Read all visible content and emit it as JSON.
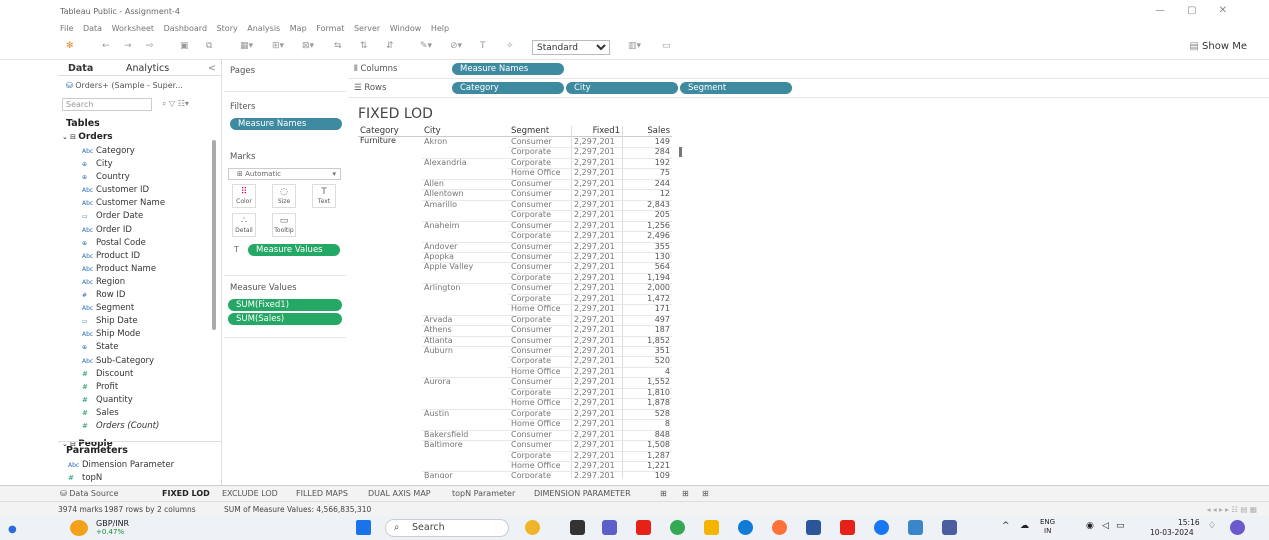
{
  "window": {
    "title": "Tableau Public - Assignment-4"
  },
  "menu": [
    "File",
    "Data",
    "Worksheet",
    "Dashboard",
    "Story",
    "Analysis",
    "Map",
    "Format",
    "Server",
    "Window",
    "Help"
  ],
  "toolbar": {
    "fit_value": "Standard",
    "show_me": "Show Me"
  },
  "data_pane": {
    "tab_data": "Data",
    "tab_analytics": "Analytics",
    "collapse": "<",
    "datasource": "Orders+ (Sample - Super...",
    "search_placeholder": "Search",
    "tables_label": "Tables",
    "orders_label": "Orders",
    "fields": [
      {
        "type": "Abc",
        "name": "Category"
      },
      {
        "type": "⊕",
        "name": "City"
      },
      {
        "type": "⊕",
        "name": "Country"
      },
      {
        "type": "Abc",
        "name": "Customer ID"
      },
      {
        "type": "Abc",
        "name": "Customer Name"
      },
      {
        "type": "▭",
        "name": "Order Date"
      },
      {
        "type": "Abc",
        "name": "Order ID"
      },
      {
        "type": "⊕",
        "name": "Postal Code"
      },
      {
        "type": "Abc",
        "name": "Product ID"
      },
      {
        "type": "Abc",
        "name": "Product Name"
      },
      {
        "type": "Abc",
        "name": "Region"
      },
      {
        "type": "#",
        "name": "Row ID"
      },
      {
        "type": "Abc",
        "name": "Segment"
      },
      {
        "type": "▭",
        "name": "Ship Date"
      },
      {
        "type": "Abc",
        "name": "Ship Mode"
      },
      {
        "type": "⊕",
        "name": "State"
      },
      {
        "type": "Abc",
        "name": "Sub-Category"
      },
      {
        "type": "#",
        "name": "Discount",
        "measure": true
      },
      {
        "type": "#",
        "name": "Profit",
        "measure": true
      },
      {
        "type": "#",
        "name": "Quantity",
        "measure": true
      },
      {
        "type": "#",
        "name": "Sales",
        "measure": true
      },
      {
        "type": "#",
        "name": "Orders (Count)",
        "measure": true,
        "italic": true
      }
    ],
    "people_label": "People",
    "parameters_label": "Parameters",
    "parameters": [
      {
        "type": "Abc",
        "name": "Dimension Parameter"
      },
      {
        "type": "#",
        "name": "topN"
      }
    ]
  },
  "cards": {
    "pages": "Pages",
    "filters": "Filters",
    "filter_pill": "Measure Names",
    "marks": "Marks",
    "mark_type": "Automatic",
    "mark_buttons": [
      {
        "name": "color",
        "label": "Color",
        "glyph": "⠿"
      },
      {
        "name": "size",
        "label": "Size",
        "glyph": "◌"
      },
      {
        "name": "text",
        "label": "Text",
        "glyph": "T"
      },
      {
        "name": "detail",
        "label": "Detail",
        "glyph": "∴"
      },
      {
        "name": "tooltip",
        "label": "Tooltip",
        "glyph": "▭"
      }
    ],
    "marks_pill": "Measure Values",
    "measure_values": "Measure Values",
    "mv_pills": [
      "SUM(Fixed1)",
      "SUM(Sales)"
    ]
  },
  "shelves": {
    "columns_label": "Columns",
    "rows_label": "Rows",
    "columns_pills": [
      "Measure Names"
    ],
    "rows_pills": [
      "Category",
      "City",
      "Segment"
    ]
  },
  "view": {
    "title": "FIXED LOD",
    "headers": [
      "Category",
      "City",
      "Segment",
      "Fixed1",
      "Sales"
    ],
    "category": "Furniture",
    "rows": [
      {
        "city": "Akron",
        "segment": "Consumer",
        "fixed1": "2,297,201",
        "sales": "149"
      },
      {
        "city": "",
        "segment": "Corporate",
        "fixed1": "2,297,201",
        "sales": "284"
      },
      {
        "city": "Alexandria",
        "segment": "Corporate",
        "fixed1": "2,297,201",
        "sales": "192"
      },
      {
        "city": "",
        "segment": "Home Office",
        "fixed1": "2,297,201",
        "sales": "75"
      },
      {
        "city": "Allen",
        "segment": "Consumer",
        "fixed1": "2,297,201",
        "sales": "244"
      },
      {
        "city": "Allentown",
        "segment": "Consumer",
        "fixed1": "2,297,201",
        "sales": "12"
      },
      {
        "city": "Amarillo",
        "segment": "Consumer",
        "fixed1": "2,297,201",
        "sales": "2,843"
      },
      {
        "city": "",
        "segment": "Corporate",
        "fixed1": "2,297,201",
        "sales": "205"
      },
      {
        "city": "Anaheim",
        "segment": "Consumer",
        "fixed1": "2,297,201",
        "sales": "1,256"
      },
      {
        "city": "",
        "segment": "Corporate",
        "fixed1": "2,297,201",
        "sales": "2,496"
      },
      {
        "city": "Andover",
        "segment": "Consumer",
        "fixed1": "2,297,201",
        "sales": "355"
      },
      {
        "city": "Apopka",
        "segment": "Consumer",
        "fixed1": "2,297,201",
        "sales": "130"
      },
      {
        "city": "Apple Valley",
        "segment": "Consumer",
        "fixed1": "2,297,201",
        "sales": "564"
      },
      {
        "city": "",
        "segment": "Corporate",
        "fixed1": "2,297,201",
        "sales": "1,194"
      },
      {
        "city": "Arlington",
        "segment": "Consumer",
        "fixed1": "2,297,201",
        "sales": "2,000"
      },
      {
        "city": "",
        "segment": "Corporate",
        "fixed1": "2,297,201",
        "sales": "1,472"
      },
      {
        "city": "",
        "segment": "Home Office",
        "fixed1": "2,297,201",
        "sales": "171"
      },
      {
        "city": "Arvada",
        "segment": "Corporate",
        "fixed1": "2,297,201",
        "sales": "497"
      },
      {
        "city": "Athens",
        "segment": "Consumer",
        "fixed1": "2,297,201",
        "sales": "187"
      },
      {
        "city": "Atlanta",
        "segment": "Consumer",
        "fixed1": "2,297,201",
        "sales": "1,852"
      },
      {
        "city": "Auburn",
        "segment": "Consumer",
        "fixed1": "2,297,201",
        "sales": "351"
      },
      {
        "city": "",
        "segment": "Corporate",
        "fixed1": "2,297,201",
        "sales": "520"
      },
      {
        "city": "",
        "segment": "Home Office",
        "fixed1": "2,297,201",
        "sales": "4"
      },
      {
        "city": "Aurora",
        "segment": "Consumer",
        "fixed1": "2,297,201",
        "sales": "1,552"
      },
      {
        "city": "",
        "segment": "Corporate",
        "fixed1": "2,297,201",
        "sales": "1,810"
      },
      {
        "city": "",
        "segment": "Home Office",
        "fixed1": "2,297,201",
        "sales": "1,878"
      },
      {
        "city": "Austin",
        "segment": "Corporate",
        "fixed1": "2,297,201",
        "sales": "528"
      },
      {
        "city": "",
        "segment": "Home Office",
        "fixed1": "2,297,201",
        "sales": "8"
      },
      {
        "city": "Bakersfield",
        "segment": "Consumer",
        "fixed1": "2,297,201",
        "sales": "848"
      },
      {
        "city": "Baltimore",
        "segment": "Consumer",
        "fixed1": "2,297,201",
        "sales": "1,508"
      },
      {
        "city": "",
        "segment": "Corporate",
        "fixed1": "2,297,201",
        "sales": "1,287"
      },
      {
        "city": "",
        "segment": "Home Office",
        "fixed1": "2,297,201",
        "sales": "1,221"
      },
      {
        "city": "Bangor",
        "segment": "Corporate",
        "fixed1": "2,297,201",
        "sales": "109"
      }
    ]
  },
  "sheet_tabs": {
    "datasource": "Data Source",
    "tabs": [
      "FIXED LOD",
      "EXCLUDE LOD",
      "FILLED MAPS",
      "DUAL AXIS MAP",
      "topN Parameter",
      "DIMENSION PARAMETER"
    ],
    "active": "FIXED LOD"
  },
  "status": {
    "marks": "3974 marks",
    "rows": "1987 rows by 2 columns",
    "sum": "SUM of Measure Values: 4,566,835,310"
  },
  "taskbar": {
    "ticker_name": "GBP/INR",
    "ticker_change": "+0.47%",
    "search": "Search",
    "lang": "ENG",
    "region": "IN",
    "time": "15:16",
    "date": "10-03-2024"
  },
  "colors": {
    "pill_blue": "#3d8aa1",
    "pill_green": "#25a865"
  }
}
